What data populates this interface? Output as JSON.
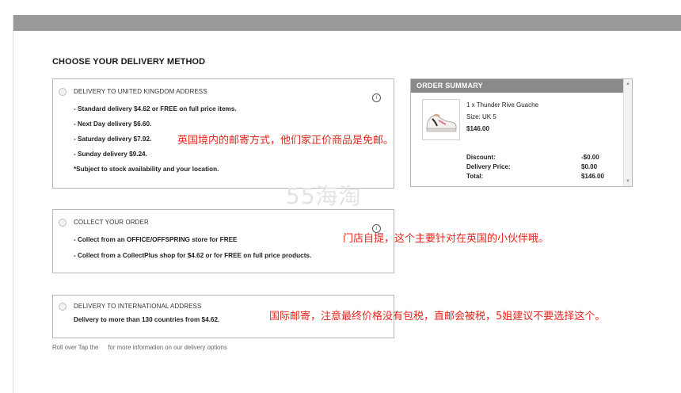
{
  "heading": "CHOOSE YOUR DELIVERY METHOD",
  "uk": {
    "title": "DELIVERY TO UNITED KINGDOM ADDRESS",
    "lines": [
      "- Standard delivery $4.62 or FREE on full price items.",
      "- Next Day delivery $6.60.",
      "- Saturday delivery $7.92.",
      "- Sunday delivery $9.24.",
      "*Subject to stock availability and your location."
    ]
  },
  "collect": {
    "title": "COLLECT YOUR ORDER",
    "lines": [
      "- Collect from an OFFICE/OFFSPRING store for FREE",
      "- Collect from a CollectPlus shop for $4.62 or for FREE on full price products."
    ]
  },
  "intl": {
    "title": "DELIVERY TO INTERNATIONAL ADDRESS",
    "line": "Delivery to more than 130 countries from $4.62."
  },
  "info_icon": "i",
  "footer": {
    "part1": "Roll over Tap the",
    "part2": "for more information on our delivery options"
  },
  "annotations": {
    "uk": "英国境内的邮寄方式，他们家正价商品是免邮。",
    "collect": "门店自提，这个主要针对在英国的小伙伴哦。",
    "intl": "国际邮寄，注意最终价格没有包税，直邮会被税，5姐建议不要选择这个。"
  },
  "watermark": "55海淘",
  "summary": {
    "title": "ORDER SUMMARY",
    "product_name": "1 x Thunder Rive Guache",
    "size": "Size: UK 5",
    "price": "$146.00",
    "discount_label": "Discount:",
    "discount_value": "-$0.00",
    "delivery_label": "Delivery Price:",
    "delivery_value": "$0.00",
    "total_label": "Total:",
    "total_value": "$146.00"
  },
  "colors": {
    "header_bar": "#9a9a9a",
    "summary_header": "#8a8a8a",
    "annotation": "#e8251d"
  }
}
